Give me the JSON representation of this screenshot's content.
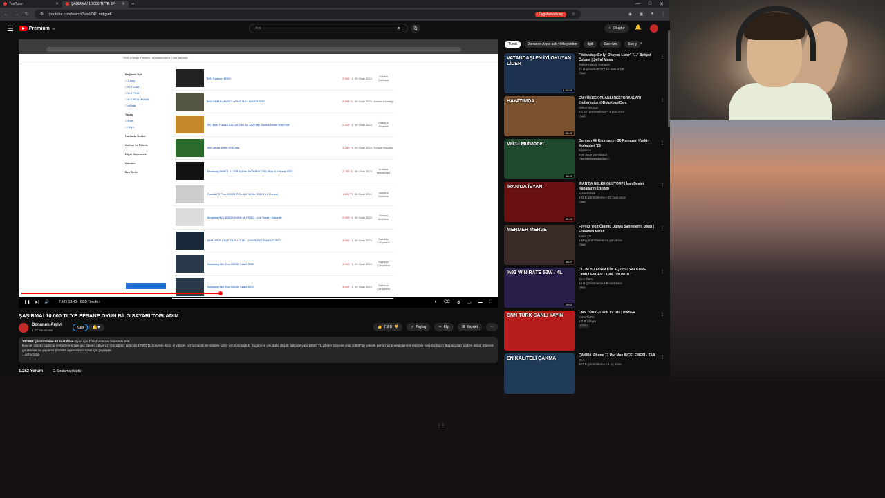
{
  "browser": {
    "tabs": [
      {
        "label": "YouTube",
        "active": false
      },
      {
        "label": "ŞAŞIRMA! 10.000 TL'YE EF",
        "active": true
      }
    ],
    "url": "youtube.com/watch?v=6iOPLmdjgwE",
    "update_badge": "Uygulamada aç"
  },
  "yt": {
    "logo": "Premium",
    "logo_region": "TR",
    "search_placeholder": "Ara",
    "create_label": "Oluştur"
  },
  "player": {
    "time": "7:42 / 18:40",
    "chapter": "SSD Tercihi",
    "progress": 0.42,
    "watermark": "ABONE OL",
    "embedded": {
      "results_label": "\"SSD (Detaylı Filtreler)\" aramasında 244 ilan bulundu.",
      "sidebar": [
        "Bağlantı Tipi",
        "Takas",
        "Haritada Göster",
        "Kelime ile Filtrele",
        "Diğer Seçenekler",
        "Kimden",
        "İlan Tarihi"
      ],
      "listings": [
        {
          "name": "MSI Spatium M390",
          "price": "2.000 TL",
          "date": "09 Ocak 2024",
          "loc": "Ankara Çankaya"
        },
        {
          "name": "MSI SPATIUM M371 NVME M.2 / 500 GB SSD",
          "price": "2.999 TL",
          "date": "09 Ocak 2024",
          "loc": "Ankara Altındağ"
        },
        {
          "name": "SK Hynix P31NS 512 GB Gen 4x 7200 MB Okuma Nvme 5000 MB",
          "price": "2.300 TL",
          "date": "09 Ocak 2024",
          "loc": "İstanbul Ataşehir"
        },
        {
          "name": "500 gb wd green SSD sıfır",
          "price": "2.250 TL",
          "date": "09 Ocak 2024",
          "loc": "Konya Selçuklu"
        },
        {
          "name": "Samsung PM9C1 512GB NVMe 2000MB/S 2280 Pcie 4.0 Nvme SSD",
          "price": "2.750 TL",
          "date": "09 Ocak 2024",
          "loc": "Antalya Muratpaşa"
        },
        {
          "name": "Crucial P3 Plus 500GB PCIe 4.0 NVMe SSD 5 Yıl Garanti",
          "price": "1.800 TL",
          "date": "09 Ocak 2024",
          "loc": "İstanbul Üsküdar"
        },
        {
          "name": "Kingston NV1 500GB NVMe M.2 SSD - Çok Temiz / Garantili",
          "price": "2.000 TL",
          "date": "09 Ocak 2024",
          "loc": "Ankara Keçiören"
        },
        {
          "name": "SAMSUNG 970 EVO PLUS M2 - SAMSUNG 860 EVO SSD",
          "price": "3.000 TL",
          "date": "09 Ocak 2024",
          "loc": "Samsun Çarşamba"
        },
        {
          "name": "Samsung 860 Evo 500GB Sata3 SSD",
          "price": "3.000 TL",
          "date": "09 Ocak 2024",
          "loc": "Samsun Çarşamba"
        },
        {
          "name": "Samsung 860 Evo 500GB Sata3 SSD",
          "price": "3.000 TL",
          "date": "09 Ocak 2024",
          "loc": "Samsun Çarşamba"
        }
      ]
    }
  },
  "video": {
    "title": "ŞAŞIRMA! 10.000 TL'YE EFSANE OYUN BİLGİSAYARI TOPLADIM",
    "channel": "Donanım Arşivi",
    "subscribers": "1,27 Mn abone",
    "join_label": "Katıl",
    "likes": "7,9 B",
    "share_label": "Paylaş",
    "clip_label": "Klip",
    "save_label": "Kaydet",
    "description_meta": "130.953 görüntüleme  15 saat önce",
    "trend": "Oyun için Trend Videolar listesinde #28",
    "description": "İkinci el sistem toplama rehberlerine tam gaz devam ediyoruz! Geçtiğimiz videoda 17000 TL bütçeyle ikinci el yüksek performanslı bir sistemi sizler için sunmuştuk. Bugün ise çok daha düşük bütçede yani 10000 TL gibi bir bütçede yine 1080P'de yüksek performans verebilen bir sistemle karşınızdayız! Bu parçaları alırken dikkat etmeniz gerekenler ve yapılırsa pazarlık aşamalarını sizler için paylaştık.",
    "more": "...daha fazla",
    "comments_count": "1.252 Yorum",
    "sort_label": "Sıralama ölçütü"
  },
  "sidebar": {
    "chips": [
      "Tümü",
      "Donanım Arşivi adlı yükleyiciden",
      "İlgili",
      "Size özel",
      "Son y"
    ],
    "recommendations": [
      {
        "title": "\"Vatandaşı En İyi Okuyan Lider\" \"...\" Behçet Özkura | Şeffaf Masa",
        "channel": "Taha Hüseyin Karagöz",
        "meta": "37 B görüntüleme • 22 saat önce",
        "badge": "Yeni",
        "duration": "1:00:55",
        "thumb_text": "VATANDAŞI EN İYİ OKUYAN LİDER",
        "thumb_color": "#1d3350"
      },
      {
        "title": "EN YÜKSEK PUANLI RESTORANLARI @uberkuloz @DolukbaslCem",
        "channel": "Orkun Işıtmak",
        "meta": "2,1 Mn görüntüleme • 1 gün önce",
        "badge": "Yeni",
        "duration": "36:42",
        "thumb_text": "HAYATIMDA",
        "thumb_color": "#7a5230"
      },
      {
        "title": "Durman Ali Erzincanlı - 20 Ramazan | Vakt-i Muhabbet '25",
        "channel": "MyMecia",
        "meta": "9 yy önce yayınlandı",
        "badge": "YouTube tarafından öne...",
        "duration": "46:22",
        "thumb_text": "Vakt-i Muhabbet",
        "thumb_color": "#1f4a2e"
      },
      {
        "title": "İRAN'DA NELER OLUYOR? | İran Devlet Kanallarını İzledim",
        "channel": "AtaberkBilik",
        "meta": "433 B görüntüleme • 22 saat önce",
        "badge": "Yeni",
        "duration": "22:00",
        "thumb_text": "İRAN'DA İSYAN!",
        "thumb_color": "#6b1010"
      },
      {
        "title": "Feyyaz Yiğit Ölümlü Dünya Sahnelerini İzledi | Fenomen Mizah",
        "channel": "KAFA TV",
        "meta": "1 Mn görüntüleme • 6 gün önce",
        "badge": "Yeni",
        "duration": "38:47",
        "thumb_text": "MERMER MERVE",
        "thumb_color": "#3a2a28"
      },
      {
        "title": "OLUM BU ADAM KİM AQ?? 93 WR KORE CHALLENGER OLAN OYUNCU ...",
        "channel": "Şeni Ötesi",
        "meta": "18 B görüntüleme • 9 saat önce",
        "badge": "Yeni",
        "duration": "26:03",
        "thumb_text": "%93 WIN RATE 52W / 4L",
        "thumb_color": "#2a1f4a"
      },
      {
        "title": "CNN TÜRK - Canlı TV izle | HABER",
        "channel": "CNN TÜRK",
        "meta": "4,3 B izleyici",
        "badge": "CANLI",
        "duration": "",
        "thumb_text": "CNN TÜRK CANLI YAYIN",
        "thumb_color": "#b71c1c"
      },
      {
        "title": "ÇAKMA iPhone 17 Pro Max İNCELEMESİ - TAA",
        "channel": "TAA",
        "meta": "507 B görüntüleme • 1 ay önce",
        "badge": "",
        "duration": "",
        "thumb_text": "EN KALİTELİ ÇAKMA",
        "thumb_color": "#203a5a"
      }
    ]
  }
}
